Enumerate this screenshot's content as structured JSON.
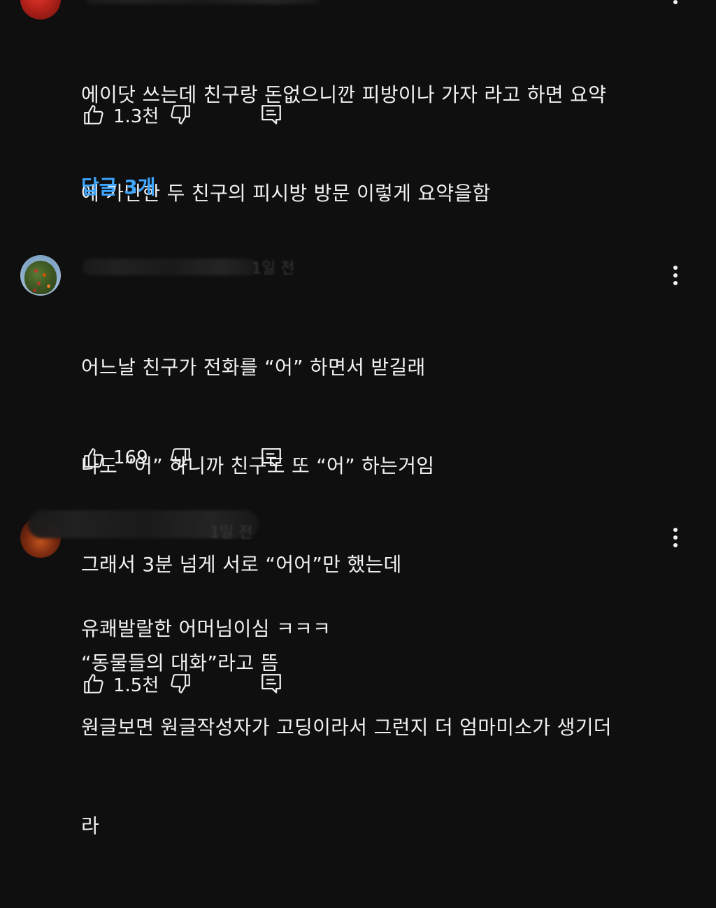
{
  "comments": [
    {
      "lines": [
        "에이닷 쓰는데 친구랑 돈없으니깐 피방이나 가자 라고 하면 요약",
        "에 가난한 두 친구의 피시방 방문 이렇게 요약을함"
      ],
      "likes": "1.3천",
      "replies_label": "답글 3개"
    },
    {
      "time": "1일 전",
      "lines": [
        "어느날 친구가 전화를 “어” 하면서 받길래",
        "나도 ”어” 하니까 친구도 또 “어” 하는거임",
        "그래서 3분 넘게 서로 “어어”만 했는데",
        "“동물들의 대화”라고 뜸"
      ],
      "likes": "169"
    },
    {
      "time": "1일 전",
      "lines": [
        "유쾌발랄한 어머님이심 ㅋㅋㅋ",
        "원글보면 원글작성자가 고딩이라서 그런지 더 엄마미소가 생기더",
        "라"
      ],
      "likes": "1.5천"
    }
  ],
  "icons": {
    "like": "thumbs-up-icon",
    "dislike": "thumbs-down-icon",
    "reply": "reply-comment-icon",
    "more": "more-vertical-icon"
  },
  "colors": {
    "background": "#0f0f0f",
    "text": "#f1f1f1",
    "link": "#3ea6ff"
  }
}
